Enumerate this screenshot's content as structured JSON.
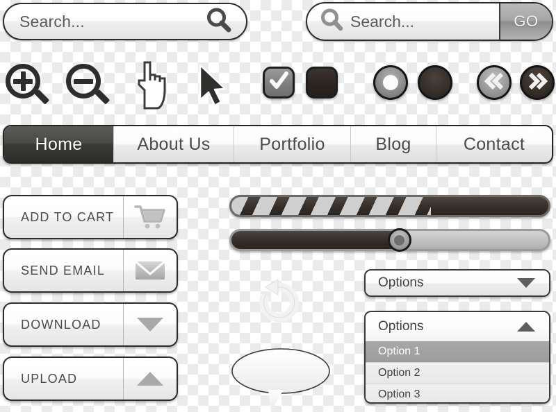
{
  "search_primary": {
    "name": "search-bar",
    "placeholder": "Search...",
    "value": "",
    "icon": "search-icon"
  },
  "search_with_button": {
    "name": "search-bar-with-go",
    "placeholder": "Search...",
    "value": "",
    "icon": "search-icon",
    "button_label": "GO"
  },
  "icons": {
    "zoom_in": "zoom-in-icon",
    "zoom_out": "zoom-out-icon",
    "hand": "hand-pointer-cursor-icon",
    "arrow": "arrow-cursor-icon",
    "refresh": "refresh-icon",
    "speech_bubble": "speech-bubble-icon",
    "cart": "shopping-cart-icon",
    "envelope": "envelope-icon",
    "triangle_down": "triangle-down-icon",
    "triangle_up": "triangle-up-icon",
    "chevron_left": "double-chevron-left-icon",
    "chevron_right": "double-chevron-right-icon",
    "check": "check-icon"
  },
  "controls": {
    "checkbox_checked": {
      "name": "checkbox-checked",
      "state": "checked"
    },
    "checkbox_unchecked": {
      "name": "checkbox-unchecked",
      "state": "unchecked"
    },
    "radio_selected": {
      "name": "radio-selected",
      "state": "selected"
    },
    "radio_unselected": {
      "name": "radio-unselected",
      "state": "unselected"
    },
    "prev_button": {
      "name": "previous-button",
      "style": "light"
    },
    "next_button": {
      "name": "next-button",
      "style": "dark"
    }
  },
  "navigation": {
    "active_index": 0,
    "items": [
      {
        "label": "Home"
      },
      {
        "label": "About Us"
      },
      {
        "label": "Portfolio"
      },
      {
        "label": "Blog"
      },
      {
        "label": "Contact"
      }
    ]
  },
  "action_buttons": [
    {
      "label": "ADD TO CART",
      "icon": "shopping-cart-icon"
    },
    {
      "label": "SEND EMAIL",
      "icon": "envelope-icon"
    },
    {
      "label": "DOWNLOAD",
      "icon": "triangle-down-icon"
    },
    {
      "label": "UPLOAD",
      "icon": "triangle-up-icon"
    }
  ],
  "progress_bar": {
    "name": "progress-bar",
    "percent": 63,
    "style": "striped"
  },
  "slider": {
    "name": "slider",
    "percent": 53
  },
  "dropdown_closed": {
    "name": "dropdown-collapsed",
    "label": "Options",
    "caret": "chevron-down-icon",
    "expanded": false
  },
  "dropdown_open": {
    "name": "dropdown-expanded",
    "label": "Options",
    "caret": "chevron-up-icon",
    "expanded": true,
    "selected_index": 0,
    "options": [
      {
        "label": "Option 1"
      },
      {
        "label": "Option 2"
      },
      {
        "label": "Option 3"
      }
    ]
  },
  "colors": {
    "dark": "#2b2b28",
    "mid_gray": "#8e8e8e",
    "light_gray": "#e6e6e6",
    "text": "#4a4a4a",
    "selected_bg": "#a0a0a0"
  }
}
